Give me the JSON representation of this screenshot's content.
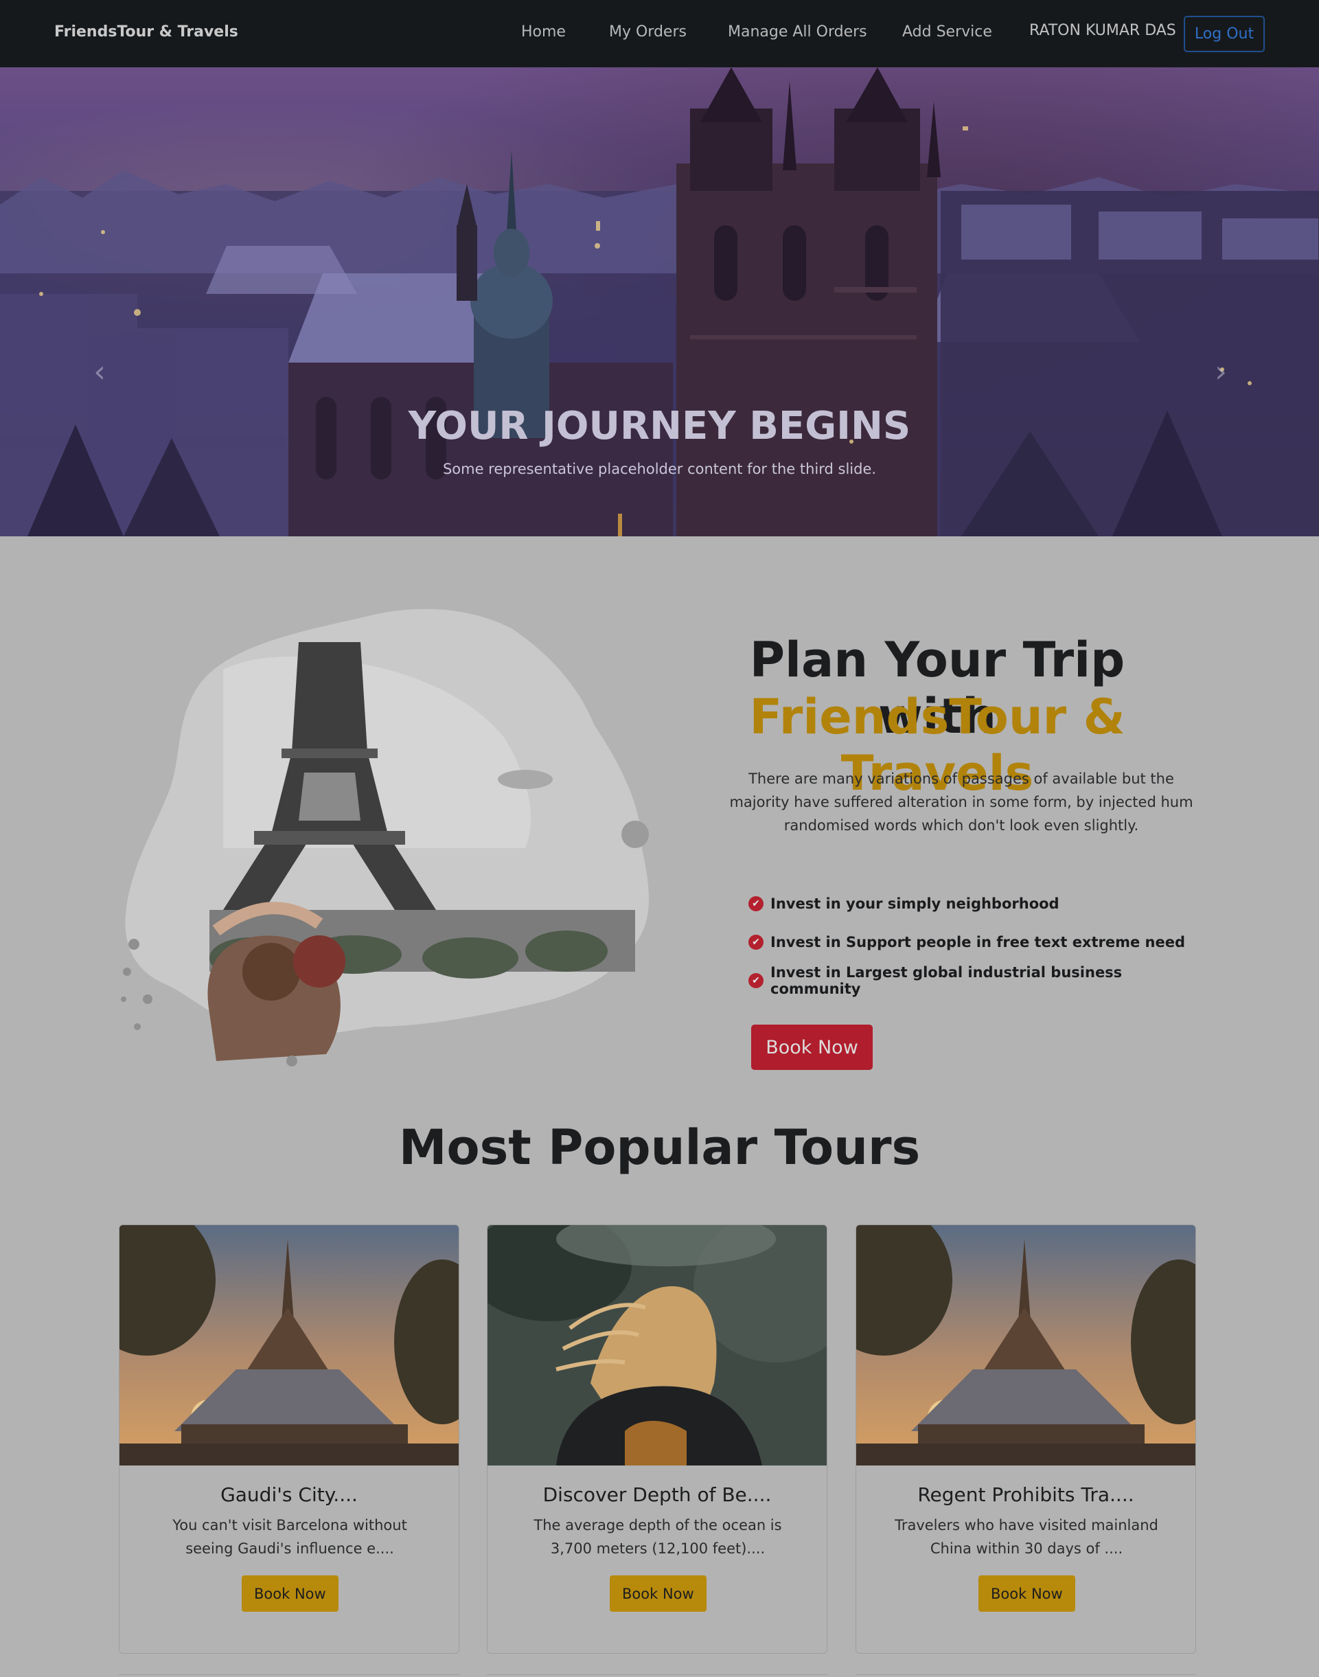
{
  "navbar": {
    "brand": "FriendsTour & Travels",
    "links": [
      {
        "label": "Home"
      },
      {
        "label": "My Orders"
      },
      {
        "label": "Manage All Orders"
      },
      {
        "label": "Add Service"
      }
    ],
    "user_name": "RATON KUMAR DAS",
    "logout_label": "Log Out"
  },
  "hero": {
    "title": "YOUR JOURNEY BEGINS",
    "subtitle": "Some representative placeholder content for the third slide.",
    "prev_icon": "chevron-left-icon",
    "next_icon": "chevron-right-icon"
  },
  "plan": {
    "title_line1": "Plan Your Trip with",
    "title_line2": "FriendsTour & Travels",
    "description": "There are many variations of passages of available but the majority have suffered alteration in some form, by injected hum randomised words which don't look even slightly.",
    "features": [
      "Invest in your simply neighborhood",
      "Invest in Support people in free text extreme need",
      "Invest in Largest global industrial business community"
    ],
    "book_label": "Book Now",
    "image_icon": "eiffel-tower-image"
  },
  "popular": {
    "title": "Most Popular Tours",
    "cards": [
      {
        "title": "Gaudi's City....",
        "text": "You can't visit Barcelona without seeing Gaudi's influence e....",
        "button": "Book Now",
        "image": "temple-sunset-image"
      },
      {
        "title": "Discover Depth of Be....",
        "text": "The average depth of the ocean is 3,700 meters (12,100 feet)....",
        "button": "Book Now",
        "image": "woman-hair-wind-image"
      },
      {
        "title": "Regent Prohibits Tra....",
        "text": "Travelers who have visited mainland China within 30 days of ....",
        "button": "Book Now",
        "image": "temple-sunset-image"
      }
    ]
  },
  "colors": {
    "navbar_bg": "#16191c",
    "page_bg": "#b3b3b3",
    "accent_gold": "#b1830b",
    "book_red": "#b01d2c",
    "logout_blue": "#2f6fc7"
  }
}
